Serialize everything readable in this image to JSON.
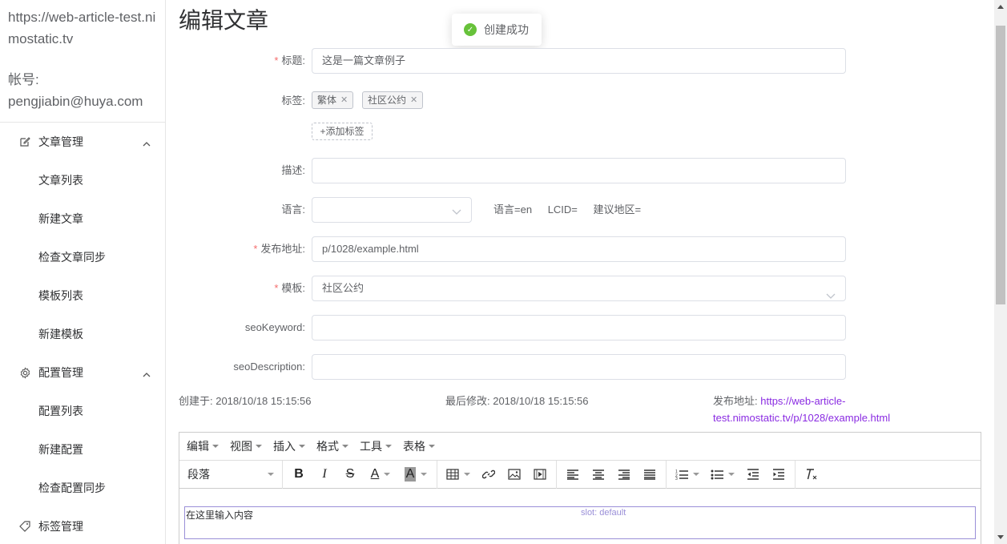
{
  "sidebar": {
    "site_url": "https://web-article-test.nimostatic.tv",
    "account_label": "帐号:",
    "account_email": "pengjiabin@huya.com",
    "groups": [
      {
        "label": "文章管理",
        "icon": "edit-icon",
        "items": [
          "文章列表",
          "新建文章",
          "检查文章同步",
          "模板列表",
          "新建模板"
        ]
      },
      {
        "label": "配置管理",
        "icon": "gear-icon",
        "items": [
          "配置列表",
          "新建配置",
          "检查配置同步"
        ]
      },
      {
        "label": "标签管理",
        "icon": "tag-icon",
        "items": []
      }
    ]
  },
  "page": {
    "title": "编辑文章",
    "toast": "创建成功"
  },
  "form": {
    "title_label": "标题:",
    "title_value": "这是一篇文章例子",
    "tags_label": "标签:",
    "tags": [
      "繁体",
      "社区公约"
    ],
    "add_tag": "+添加标签",
    "desc_label": "描述:",
    "desc_value": "",
    "lang_label": "语言:",
    "lang_value": "",
    "lang_info": [
      "语言=en",
      "LCID=",
      "建议地区="
    ],
    "url_label": "发布地址:",
    "url_value": "p/1028/example.html",
    "template_label": "模板:",
    "template_value": "社区公约",
    "seo_keyword_label": "seoKeyword:",
    "seo_keyword_value": "",
    "seo_desc_label": "seoDescription:",
    "seo_desc_value": ""
  },
  "meta": {
    "created": "创建于: 2018/10/18 15:15:56",
    "modified": "最后修改: 2018/10/18 15:15:56",
    "publish_label": "发布地址:",
    "publish_link_line1": "https://web-article-",
    "publish_link_line2": "test.nimostatic.tv/p/1028/example.html"
  },
  "editor": {
    "menus": [
      "编辑",
      "视图",
      "插入",
      "格式",
      "工具",
      "表格"
    ],
    "paragraph": "段落",
    "placeholder": "在这里输入内容",
    "slot_label": "slot: default"
  }
}
